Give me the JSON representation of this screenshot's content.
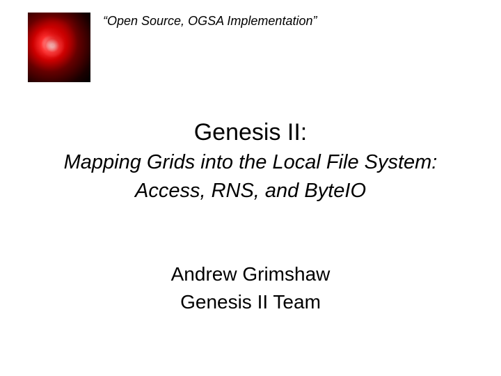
{
  "header": {
    "tagline": "“Open Source, OGSA Implementation”"
  },
  "title": {
    "main": "Genesis II:",
    "subtitle_line1": "Mapping Grids into the Local File System:",
    "subtitle_line2": "Access, RNS, and ByteIO"
  },
  "author": {
    "name": "Andrew Grimshaw",
    "team": "Genesis II Team"
  }
}
